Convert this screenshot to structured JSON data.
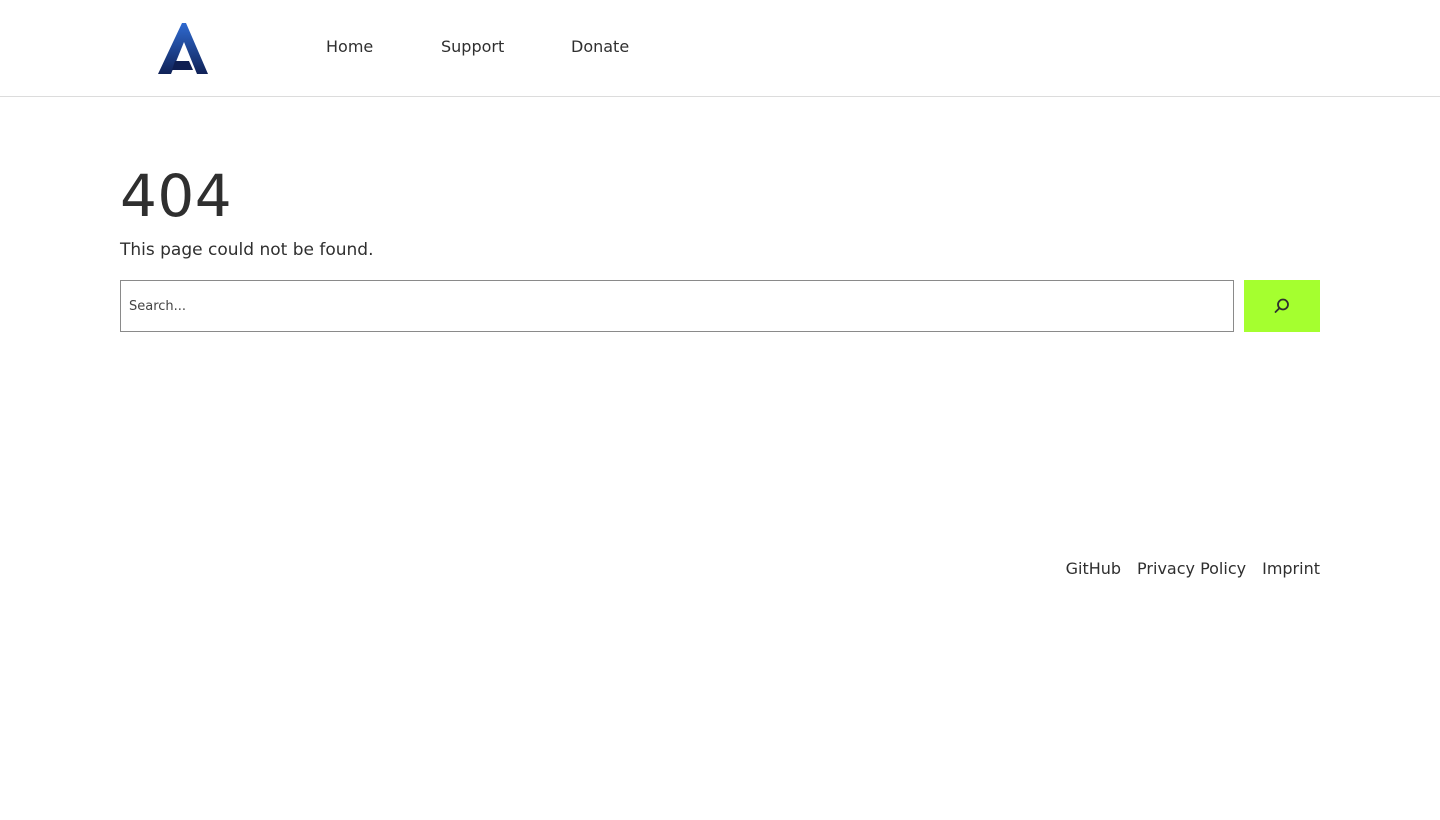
{
  "header": {
    "logo_icon": "stylized-a-logo",
    "nav": {
      "items": [
        {
          "label": "Home"
        },
        {
          "label": "Support"
        },
        {
          "label": "Donate"
        }
      ]
    }
  },
  "main": {
    "title": "404",
    "subtitle": "This page could not be found.",
    "search": {
      "placeholder": "Search...",
      "value": "",
      "button_icon": "search-icon",
      "button_color": "#a5ff2f"
    }
  },
  "footer": {
    "links": [
      {
        "label": "GitHub"
      },
      {
        "label": "Privacy Policy"
      },
      {
        "label": "Imprint"
      }
    ]
  },
  "colors": {
    "text": "#2f2f2f",
    "logo_dark": "#0f1f52",
    "logo_light": "#2f5fbf",
    "accent": "#a5ff2f",
    "divider": "#dcdcdc"
  }
}
